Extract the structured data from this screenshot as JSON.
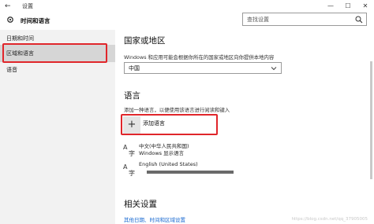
{
  "window": {
    "back_glyph": "←",
    "title": "设置",
    "minimize": "—",
    "maximize": "☐",
    "close": "✕"
  },
  "header": {
    "breadcrumb": "时间和语言",
    "search_placeholder": "查找设置",
    "home_icon": "gear-icon",
    "search_icon": "search-icon"
  },
  "sidebar": {
    "items": [
      {
        "label": "日期和时间",
        "selected": false
      },
      {
        "label": "区域和语言",
        "selected": true
      },
      {
        "label": "语音",
        "selected": false
      }
    ]
  },
  "region": {
    "heading": "国家或地区",
    "description": "Windows 和应用可能会根据你所在的国家或地区向你提供本地内容",
    "selected_country": "中国"
  },
  "languages": {
    "heading": "语言",
    "description": "添加一种语言，以便使用该语言进行阅读和键入",
    "add_button_glyph": "+",
    "add_button_label": "添加语言",
    "items": [
      {
        "name": "中文(中华人民共和国)",
        "sub": "Windows 显示语言",
        "icon": "language-icon"
      },
      {
        "name": "English (United States)",
        "sub": "",
        "icon": "language-icon",
        "progress": 1.0
      }
    ]
  },
  "related": {
    "heading": "相关设置",
    "link": "其他日期、时间和区域设置"
  },
  "highlight_color": "#e0262b",
  "watermark": "https://blog.csdn.net/qq_37905005"
}
